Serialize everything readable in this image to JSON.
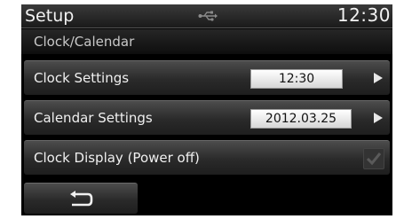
{
  "status_bar": {
    "title": "Setup",
    "time": "12:30",
    "usb_icon": "usb-icon"
  },
  "sub_header": {
    "title": "Clock/Calendar"
  },
  "rows": [
    {
      "label": "Clock Settings",
      "value": "12:30",
      "action_icon": "right-arrow-icon"
    },
    {
      "label": "Calendar Settings",
      "value": "2012.03.25",
      "action_icon": "right-arrow-icon"
    },
    {
      "label": "Clock Display (Power off)",
      "checked": true,
      "enabled": false
    }
  ],
  "footer": {
    "back_icon": "back-arrow-icon"
  },
  "colors": {
    "screen_bg": "#000000",
    "row_bg": "#2a2a2a",
    "text": "#f0f0f0",
    "value_box": "#e6e6e6"
  }
}
